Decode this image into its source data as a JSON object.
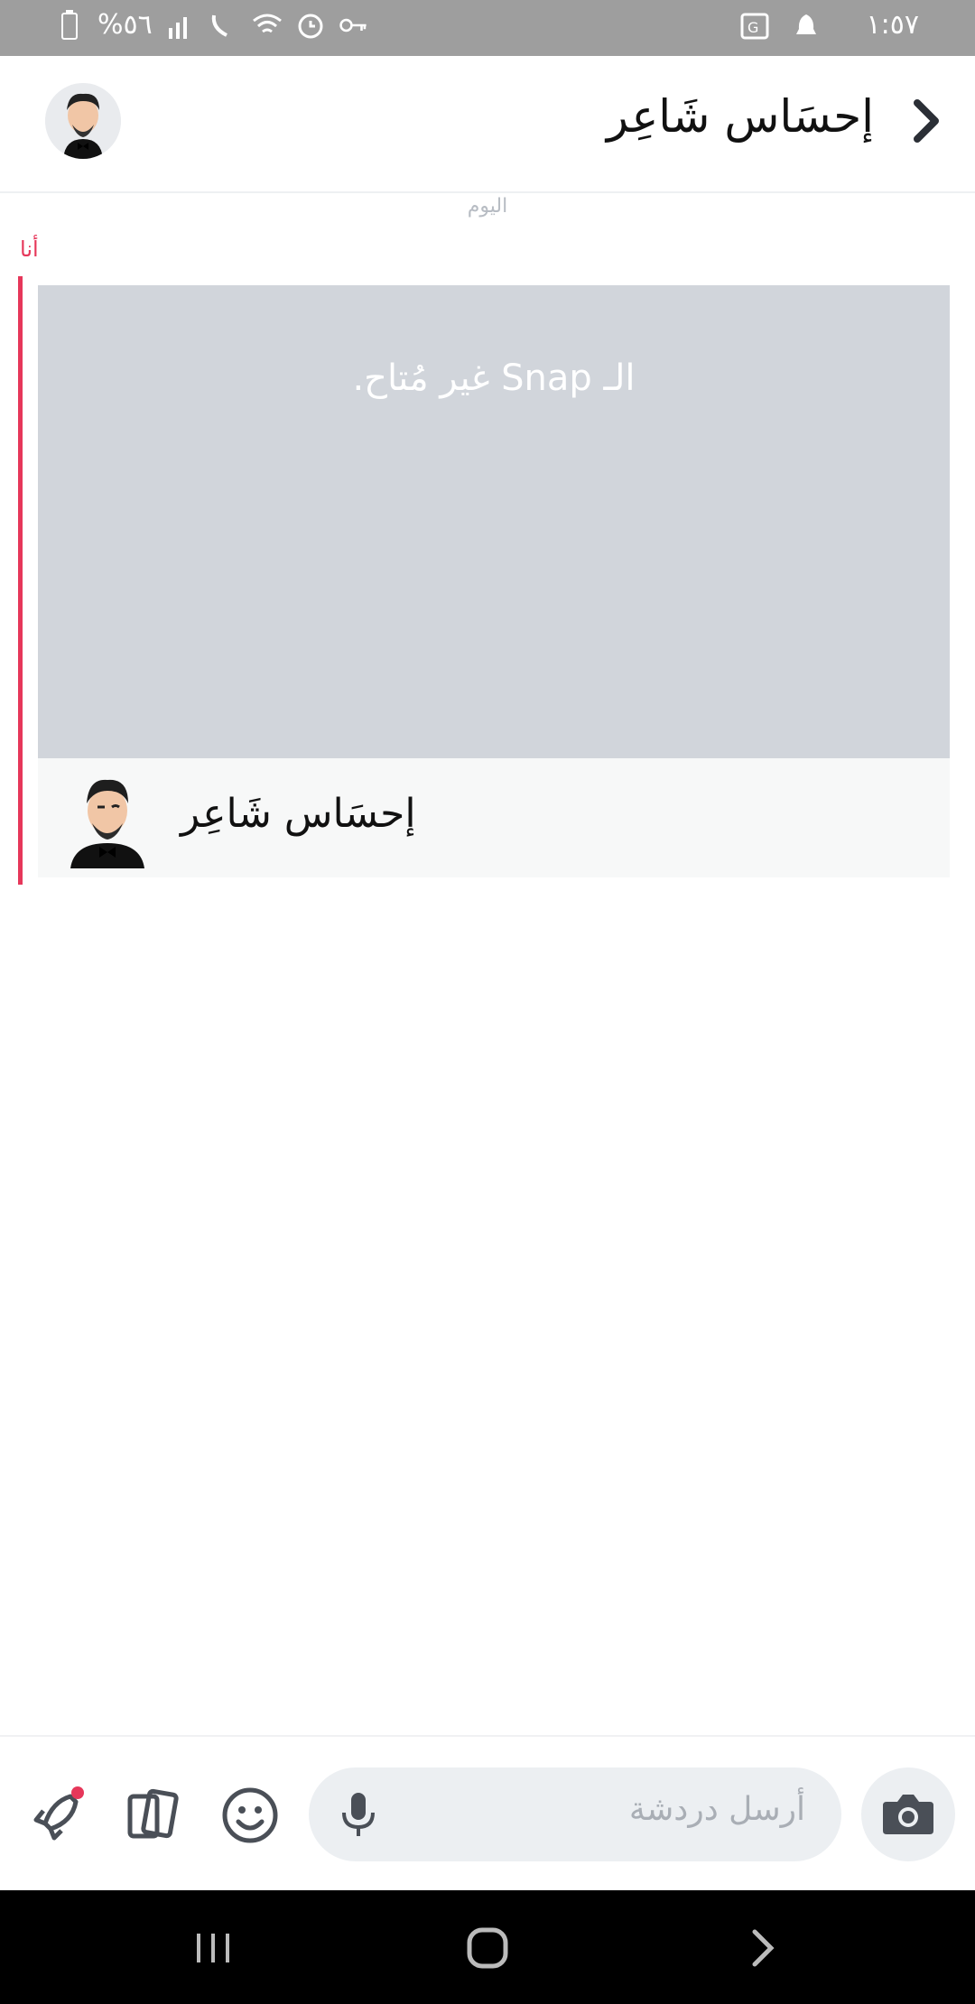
{
  "status_bar": {
    "time": "١:٥٧",
    "battery": "%٥٦",
    "icons": [
      "battery-icon",
      "signal-icon",
      "wifi-call-icon",
      "wifi-icon",
      "alarm-icon",
      "vpn-key-icon",
      "translate-icon",
      "notification-icon"
    ]
  },
  "header": {
    "title": "إحسَاس شَاعِر",
    "back_icon": "chevron-right-icon",
    "avatar": "bitmoji-avatar"
  },
  "chat": {
    "date_separator": "اليوم",
    "sender_label": "أنا",
    "snap_unavailable_text": "الـ Snap غير مُتاح.",
    "snap_author_name": "إحسَاس شَاعِر",
    "accent_color": "#e6375a",
    "card_color": "#d1d5db"
  },
  "composer": {
    "placeholder": "أرسل دردشة",
    "icons": [
      "rocket-icon",
      "cards-icon",
      "emoji-icon",
      "mic-icon",
      "camera-icon"
    ]
  },
  "navbar": {
    "icons": [
      "recent-apps-icon",
      "home-icon",
      "back-icon"
    ]
  }
}
